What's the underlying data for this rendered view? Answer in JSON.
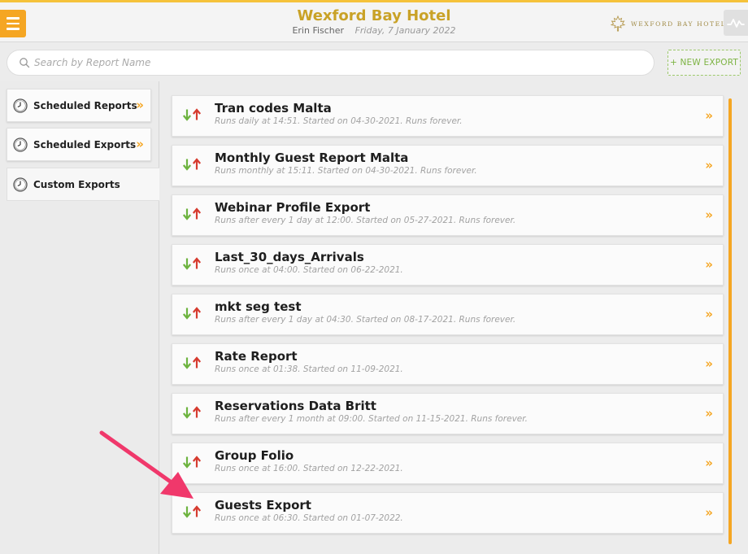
{
  "header": {
    "title": "Wexford Bay Hotel",
    "user": "Erin Fischer",
    "date": "Friday, 7 January 2022",
    "brand_text": "WEXFORD BAY HOTEL"
  },
  "search": {
    "placeholder": "Search by Report Name",
    "new_export_label": "+ NEW EXPORT"
  },
  "sidebar": {
    "items": [
      {
        "label": "Scheduled Reports",
        "icon": "clock-icon",
        "active": false
      },
      {
        "label": "Scheduled Exports",
        "icon": "clock-icon",
        "active": false
      },
      {
        "label": "Custom Exports",
        "icon": "clock-icon",
        "active": true
      }
    ]
  },
  "exports": [
    {
      "title": "Tran codes Malta",
      "desc": "Runs daily at 14:51. Started on 04-30-2021. Runs forever."
    },
    {
      "title": "Monthly Guest Report Malta",
      "desc": "Runs monthly at 15:11. Started on 04-30-2021. Runs forever."
    },
    {
      "title": "Webinar Profile Export",
      "desc": "Runs after every 1 day at 12:00. Started on 05-27-2021. Runs forever."
    },
    {
      "title": "Last_30_days_Arrivals",
      "desc": "Runs once at 04:00. Started on 06-22-2021."
    },
    {
      "title": "mkt seg test",
      "desc": "Runs after every 1 day at 04:30. Started on 08-17-2021. Runs forever."
    },
    {
      "title": "Rate Report",
      "desc": "Runs once at 01:38. Started on 11-09-2021."
    },
    {
      "title": "Reservations Data Britt",
      "desc": "Runs after every 1 month at 09:00. Started on 11-15-2021. Runs forever."
    },
    {
      "title": "Group Folio",
      "desc": "Runs once at 16:00. Started on 12-22-2021."
    },
    {
      "title": "Guests Export",
      "desc": "Runs once at 06:30. Started on 01-07-2022."
    }
  ],
  "colors": {
    "accent": "#f5a623",
    "title_gold": "#c9a227",
    "arrow_down": "#6db33f",
    "arrow_up": "#d63b2f",
    "annotation": "#f0386b",
    "new_export_green": "#7cb342"
  },
  "icons": {
    "menu": "hamburger-icon",
    "activity": "activity-icon",
    "search": "search-icon",
    "row_arrows": "download-upload-arrows-icon",
    "chevron": "double-chevron-right-icon"
  }
}
